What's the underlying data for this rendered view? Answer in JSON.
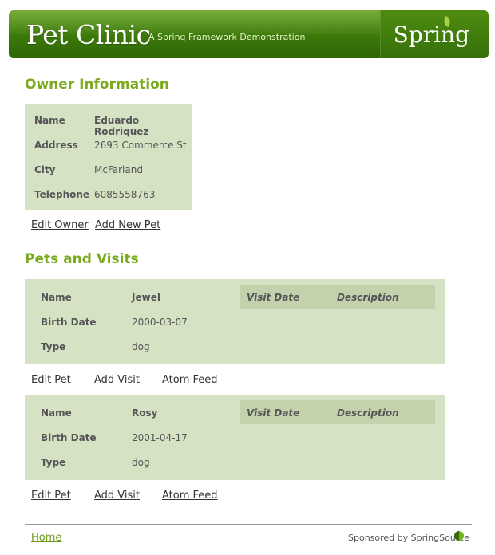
{
  "header": {
    "title": "Pet Clinic",
    "subtitle": "A Spring Framework Demonstration",
    "logo": "Spring"
  },
  "owner": {
    "heading": "Owner Information",
    "fields": [
      {
        "label": "Name",
        "value": "Eduardo Rodriquez"
      },
      {
        "label": "Address",
        "value": "2693 Commerce St."
      },
      {
        "label": "City",
        "value": "McFarland"
      },
      {
        "label": "Telephone",
        "value": "6085558763"
      }
    ],
    "actions": {
      "edit": "Edit Owner",
      "add_pet": "Add New Pet"
    }
  },
  "pets": {
    "heading": "Pets and Visits",
    "visit_columns": [
      "Visit Date",
      "Description"
    ],
    "items": [
      {
        "fields": [
          {
            "label": "Name",
            "value": "Jewel"
          },
          {
            "label": "Birth Date",
            "value": "2000-03-07"
          },
          {
            "label": "Type",
            "value": "dog"
          }
        ],
        "actions": {
          "edit": "Edit Pet",
          "add_visit": "Add Visit",
          "feed": "Atom Feed"
        }
      },
      {
        "fields": [
          {
            "label": "Name",
            "value": "Rosy"
          },
          {
            "label": "Birth Date",
            "value": "2001-04-17"
          },
          {
            "label": "Type",
            "value": "dog"
          }
        ],
        "actions": {
          "edit": "Edit Pet",
          "add_visit": "Add Visit",
          "feed": "Atom Feed"
        }
      }
    ]
  },
  "footer": {
    "home": "Home",
    "sponsor": "Sponsored by SpringSource",
    "sponsor_icon": "springsource-icon"
  },
  "colors": {
    "banner_green": "#3f7d0a",
    "heading_green": "#7aab1e",
    "box_bg": "#d6e2c4",
    "visit_header_bg": "#c3d2ad"
  }
}
